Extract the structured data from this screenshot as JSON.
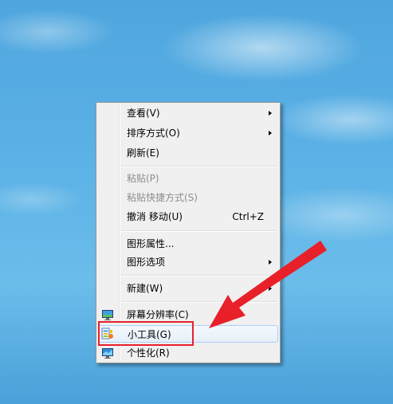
{
  "menu": {
    "items": [
      {
        "label": "查看(V)",
        "submenu": true
      },
      {
        "label": "排序方式(O)",
        "submenu": true
      },
      {
        "label": "刷新(E)"
      },
      {
        "label": "粘贴(P)",
        "disabled": true
      },
      {
        "label": "粘贴快捷方式(S)",
        "disabled": true
      },
      {
        "label": "撤消 移动(U)",
        "shortcut": "Ctrl+Z"
      },
      {
        "label": "图形属性..."
      },
      {
        "label": "图形选项",
        "submenu": true
      },
      {
        "label": "新建(W)",
        "submenu": true
      },
      {
        "label": "屏幕分辨率(C)",
        "icon": "display-icon"
      },
      {
        "label": "小工具(G)",
        "icon": "gadgets-icon",
        "highlighted": true
      },
      {
        "label": "个性化(R)",
        "icon": "personalize-icon"
      }
    ]
  },
  "annotation": {
    "box_color": "#e8202a",
    "arrow_color": "#e8202a"
  }
}
